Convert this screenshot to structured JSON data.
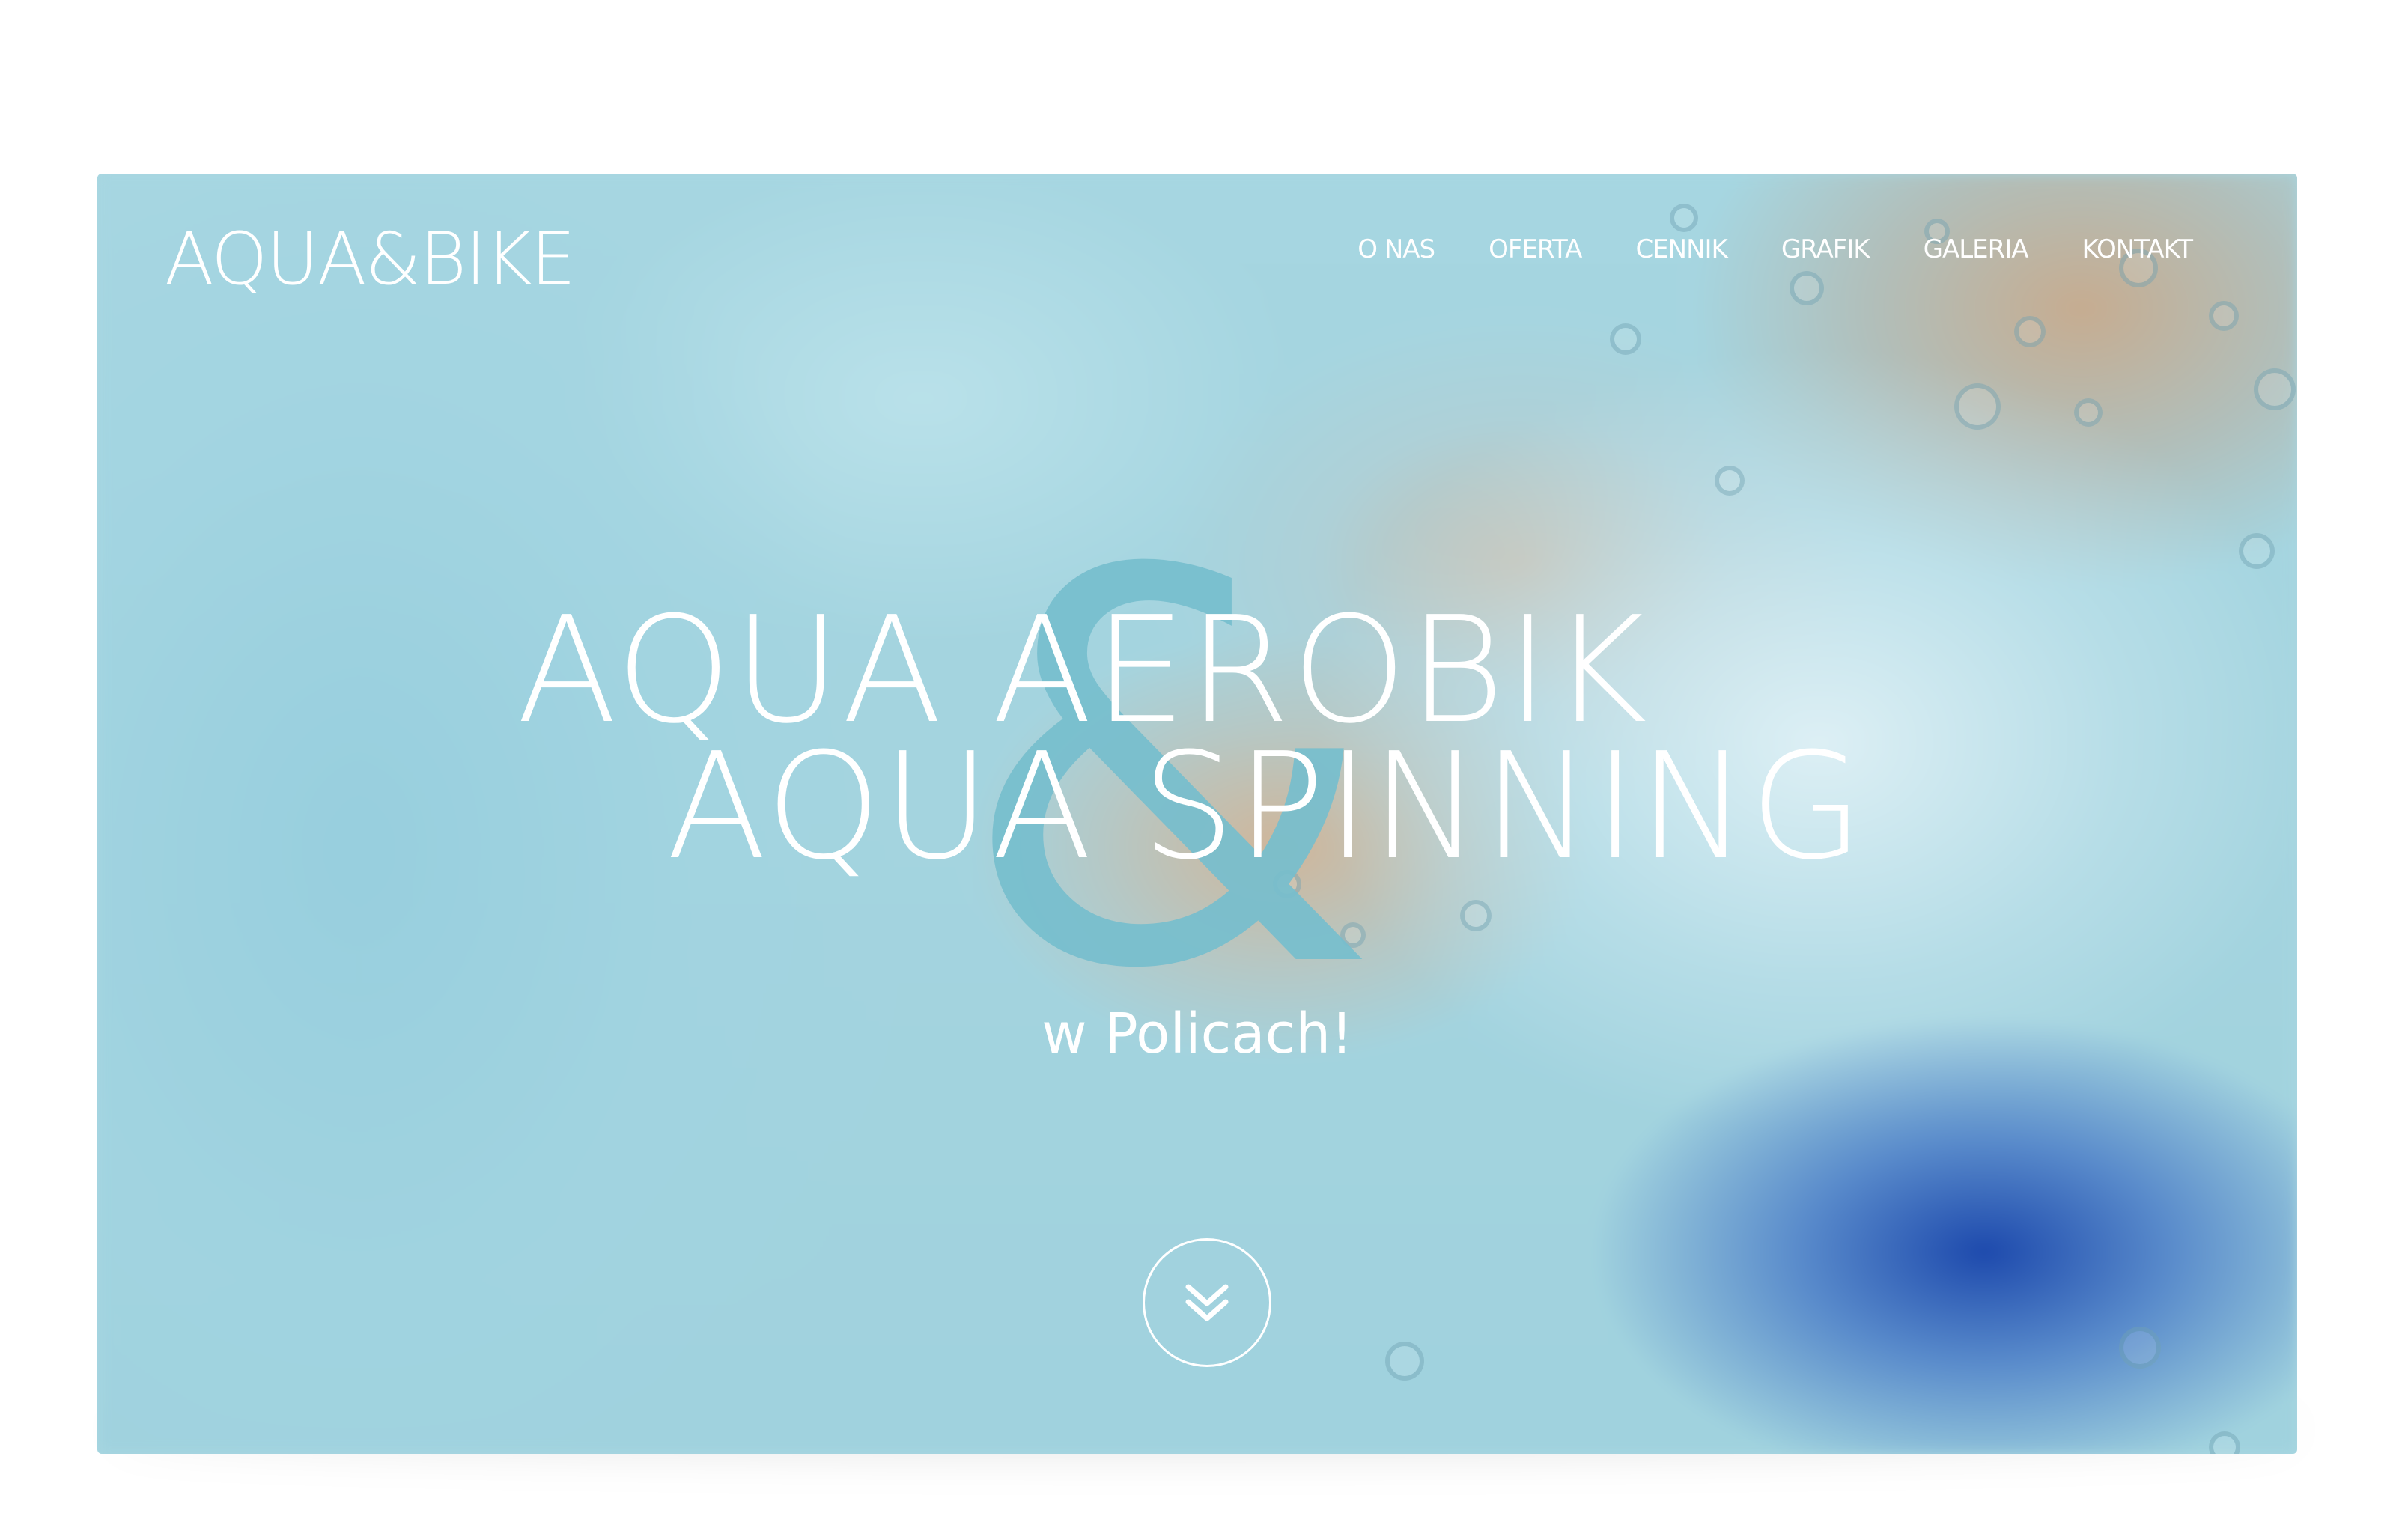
{
  "brand": {
    "logo_text": "AQUA&BIKE"
  },
  "nav": {
    "items": [
      {
        "label": "O NAS"
      },
      {
        "label": "OFERTA"
      },
      {
        "label": "CENNIK"
      },
      {
        "label": "GRAFIK"
      },
      {
        "label": "GALERIA"
      },
      {
        "label": "KONTAKT"
      }
    ]
  },
  "hero": {
    "line1": "AQUA AEROBIK",
    "line2": "AQUA SPINNING",
    "ampersand": "&",
    "subtitle": "w Policach!",
    "scroll_icon": "double-chevron-down-icon"
  },
  "colors": {
    "accent": "#76becd",
    "text": "#ffffff",
    "background": "#a6d6e1"
  }
}
